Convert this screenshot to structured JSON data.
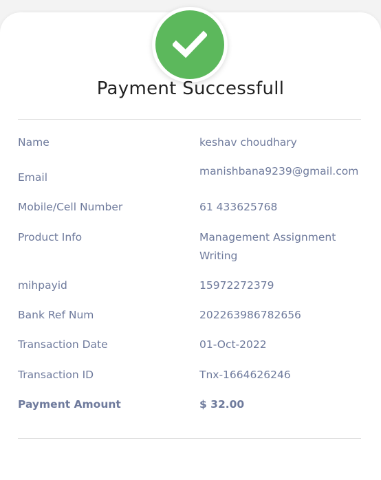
{
  "page": {
    "title": "Payment Successfull",
    "status_icon": "check-circle-icon",
    "accent_color": "#5cb85c"
  },
  "details": [
    {
      "label": "Name",
      "value": "keshav choudhary"
    },
    {
      "label": "Email",
      "value": "manishbana9239@gmail.com"
    },
    {
      "label": "Mobile/Cell Number",
      "value": "61 433625768"
    },
    {
      "label": "Product Info",
      "value": "Management Assignment Writing"
    },
    {
      "label": "mihpayid",
      "value": "15972272379"
    },
    {
      "label": "Bank Ref Num",
      "value": "202263986782656"
    },
    {
      "label": "Transaction Date",
      "value": "01-Oct-2022"
    },
    {
      "label": "Transaction ID",
      "value": "Tnx-1664626246"
    },
    {
      "label": "Payment Amount",
      "value": "$ 32.00"
    }
  ]
}
